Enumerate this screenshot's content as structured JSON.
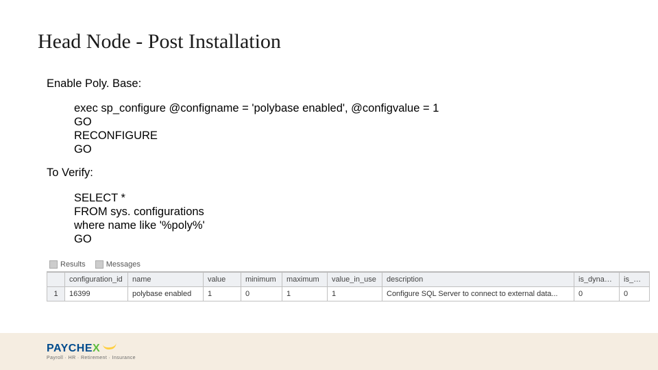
{
  "title": "Head Node - Post Installation",
  "labels": {
    "enable": "Enable Poly. Base:",
    "verify": "To Verify:"
  },
  "code": {
    "enable": "exec sp_configure @configname = 'polybase enabled', @configvalue = 1\nGO\nRECONFIGURE\nGO",
    "verify": "SELECT *\nFROM sys. configurations\nwhere name like '%poly%'\nGO"
  },
  "results": {
    "tabs": {
      "results": "Results",
      "messages": "Messages"
    },
    "columns": {
      "configuration_id": "configuration_id",
      "name": "name",
      "value": "value",
      "minimum": "minimum",
      "maximum": "maximum",
      "value_in_use": "value_in_use",
      "description": "description",
      "is_dynamic": "is_dynamic",
      "is_advanced": "is_advanced"
    },
    "rows": [
      {
        "rownum": "1",
        "configuration_id": "16399",
        "name": "polybase enabled",
        "value": "1",
        "minimum": "0",
        "maximum": "1",
        "value_in_use": "1",
        "description": "Configure SQL Server to connect to external data...",
        "is_dynamic": "0",
        "is_advanced": "0"
      }
    ]
  },
  "brand": {
    "name_main": "PAYCHE",
    "name_x": "X",
    "tagline": "Payroll · HR · Retirement · Insurance"
  }
}
